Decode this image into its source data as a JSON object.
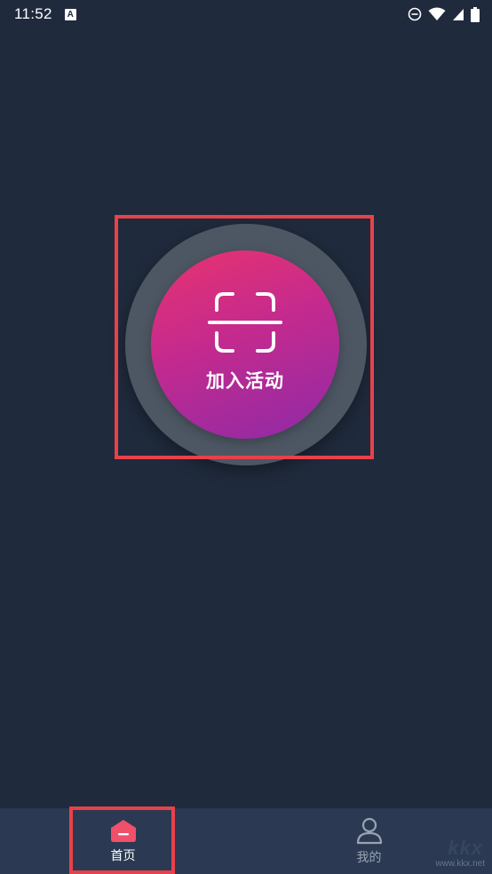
{
  "status_bar": {
    "time": "11:52",
    "notification_icon_letter": "A",
    "icons": [
      "do-not-disturb-icon",
      "wifi-icon",
      "cellular-signal-icon",
      "battery-icon"
    ]
  },
  "main": {
    "join_button": {
      "label": "加入活动",
      "icon": "scan-icon"
    }
  },
  "bottom_nav": {
    "items": [
      {
        "label": "首页",
        "icon": "home-icon",
        "active": true
      },
      {
        "label": "我的",
        "icon": "user-icon",
        "active": false
      }
    ]
  },
  "watermark": {
    "logo_text": "kkx",
    "url": "www.kkx.net"
  },
  "colors": {
    "background": "#1f2a3c",
    "nav_background": "#2b3a52",
    "accent": "#e8414a",
    "button_gradient_start": "#e8336f",
    "button_gradient_end": "#8e2aa7",
    "inactive_text": "#9aa3b2"
  }
}
